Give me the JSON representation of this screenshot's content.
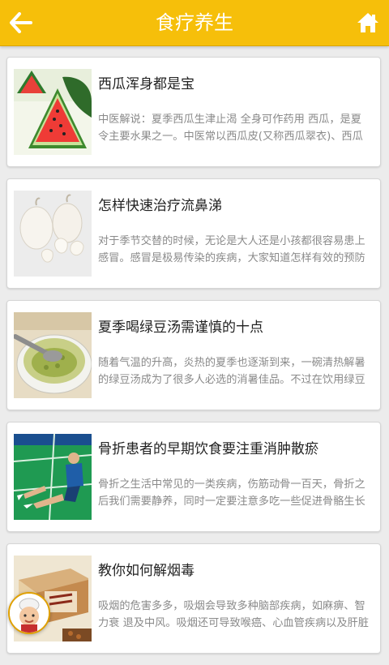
{
  "header": {
    "title": "食疗养生",
    "back_icon": "arrow-left-icon",
    "home_icon": "home-icon",
    "bg_color": "#f6bf0a"
  },
  "articles": [
    {
      "title": "西瓜浑身都是宝",
      "summary": "中医解说：夏季西瓜生津止渴 全身可作药用 西瓜，是夏令主要水果之一。中医常以西瓜皮(又称西瓜翠衣)、西瓜",
      "image": "watermelon"
    },
    {
      "title": "怎样快速治疗流鼻涕",
      "summary": "对于季节交替的时候，无论是大人还是小孩都很容易患上感冒。感冒是极易传染的疾病，大家知道怎样有效的预防",
      "image": "garlic"
    },
    {
      "title": "夏季喝绿豆汤需谨慎的十点",
      "summary": "随着气温的升高，炎热的夏季也逐渐到来，一碗清热解暑的绿豆汤成为了很多人必选的消暑佳品。不过在饮用绿豆",
      "image": "mung-bean-soup"
    },
    {
      "title": "骨折患者的早期饮食要注重消肿散瘀",
      "summary": "骨折之生活中常见的一类疾病，伤筋动骨一百天，骨折之后我们需要静养，同时一定要注意多吃一些促进骨骼生长",
      "image": "injured-athlete"
    },
    {
      "title": "教你如何解烟毒",
      "summary": "吸烟的危害多多，吸烟会导致多种脑部疾病，如麻痹、智力衰 退及中风。吸烟还可导致喉癌、心血管疾病以及肝脏",
      "image": "tea-box"
    }
  ]
}
